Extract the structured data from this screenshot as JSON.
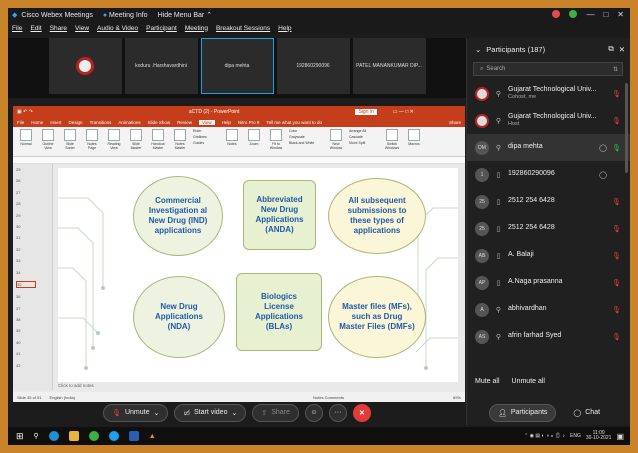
{
  "window": {
    "app_name": "Cisco Webex Meetings",
    "meeting_info": "Meeting Info",
    "hide_menu": "Hide Menu Bar ⌃",
    "controls": [
      "—",
      "□",
      "✕"
    ]
  },
  "menu": [
    "File",
    "Edit",
    "Share",
    "View",
    "Audio & Video",
    "Participant",
    "Meeting",
    "Breakout Sessions",
    "Help"
  ],
  "thumbnails": [
    {
      "name": ""
    },
    {
      "name": "koduru .Harshavardhini"
    },
    {
      "name": "dipa mehta"
    },
    {
      "name": "192860290096"
    },
    {
      "name": "PATEL MANANKUMAR DIP..."
    }
  ],
  "ppt": {
    "title": "aCTD (2) - PowerPoint",
    "signin": "Sign in",
    "tabs": [
      "File",
      "Home",
      "Insert",
      "Design",
      "Transitions",
      "Animations",
      "Slide Show",
      "Review",
      "View",
      "Help",
      "Nitro Pro 9",
      "Tell me what you want to do"
    ],
    "active_tab": "View",
    "share": "Share",
    "ribbon": [
      "Normal",
      "Outline View",
      "Slide Sorter",
      "Notes Page",
      "Reading View",
      "Slide Master",
      "Handout Master",
      "Notes Master",
      "Ruler",
      "Gridlines",
      "Guides",
      "Notes",
      "Zoom",
      "Fit to Window",
      "Color",
      "Grayscale",
      "Black and White",
      "New Window",
      "Arrange All",
      "Cascade",
      "Move Split",
      "Switch Windows",
      "Macros"
    ],
    "ribbon_groups": [
      "Presentation Views",
      "Master Views",
      "Show",
      "Zoom",
      "Color/Grayscale",
      "Window",
      "Macros"
    ],
    "slide_numbers": [
      "25",
      "26",
      "27",
      "28",
      "29",
      "30",
      "31",
      "32",
      "33",
      "34",
      "35",
      "36",
      "37",
      "38",
      "39",
      "40",
      "41",
      "42"
    ],
    "nodes": [
      {
        "text": "Commercial Investigation al New Drug (IND) applications"
      },
      {
        "text": "Abbreviated New Drug Applications (ANDA)"
      },
      {
        "text": "All subsequent submissions to these types of applications"
      },
      {
        "text": "New Drug Applications (NDA)"
      },
      {
        "text": "Biologics License Applications (BLAs)"
      },
      {
        "text": "Master files (MFs), such as Drug Master Files (DMFs)"
      }
    ],
    "notes": "Click to add notes",
    "status_left": "Slide 35 of 51",
    "status_lang": "English (India)",
    "status_right": "Notes   Comments",
    "zoom": "69%"
  },
  "controls": {
    "unmute": "Unmute",
    "start_video": "Start video",
    "share": "Share",
    "more": "···"
  },
  "participants": {
    "title": "Participants (187)",
    "search_placeholder": "Search",
    "list": [
      {
        "initials": "",
        "name": "Gujarat Technological Univ...",
        "role": "Cohost, me",
        "mic": "muted",
        "icon": "⚲"
      },
      {
        "initials": "",
        "name": "Gujarat Technological Univ...",
        "role": "Host",
        "mic": "muted",
        "icon": "⚲"
      },
      {
        "initials": "DM",
        "name": "dipa mehta",
        "role": "",
        "mic": "on",
        "icon": "⚲",
        "selected": true
      },
      {
        "initials": "1",
        "name": "192860290096",
        "role": "",
        "mic": "none",
        "icon": "▯"
      },
      {
        "initials": "25",
        "name": "2512 254 6428",
        "role": "",
        "mic": "muted",
        "icon": "▯"
      },
      {
        "initials": "25",
        "name": "2512 254 6428",
        "role": "",
        "mic": "muted",
        "icon": "▯"
      },
      {
        "initials": "AB",
        "name": "A. Balaji",
        "role": "",
        "mic": "muted",
        "icon": "▯"
      },
      {
        "initials": "AP",
        "name": "A.Naga prasanna",
        "role": "",
        "mic": "muted",
        "icon": "▯"
      },
      {
        "initials": "A",
        "name": "abhivardhan",
        "role": "",
        "mic": "muted",
        "icon": "⚲"
      },
      {
        "initials": "AS",
        "name": "afrin farhad Syed",
        "role": "",
        "mic": "muted",
        "icon": "⚲"
      }
    ],
    "mute_all": "Mute all",
    "unmute_all": "Unmute all",
    "btn_participants": "Participants",
    "btn_chat": "Chat"
  },
  "taskbar": {
    "time": "11:09",
    "date": "30-10-2021",
    "lang": "ENG"
  },
  "colors": {
    "accent": "#1ea0e6",
    "end": "#e23b3b",
    "ppt": "#c43e1c",
    "node_text": "#1f5aa8"
  }
}
